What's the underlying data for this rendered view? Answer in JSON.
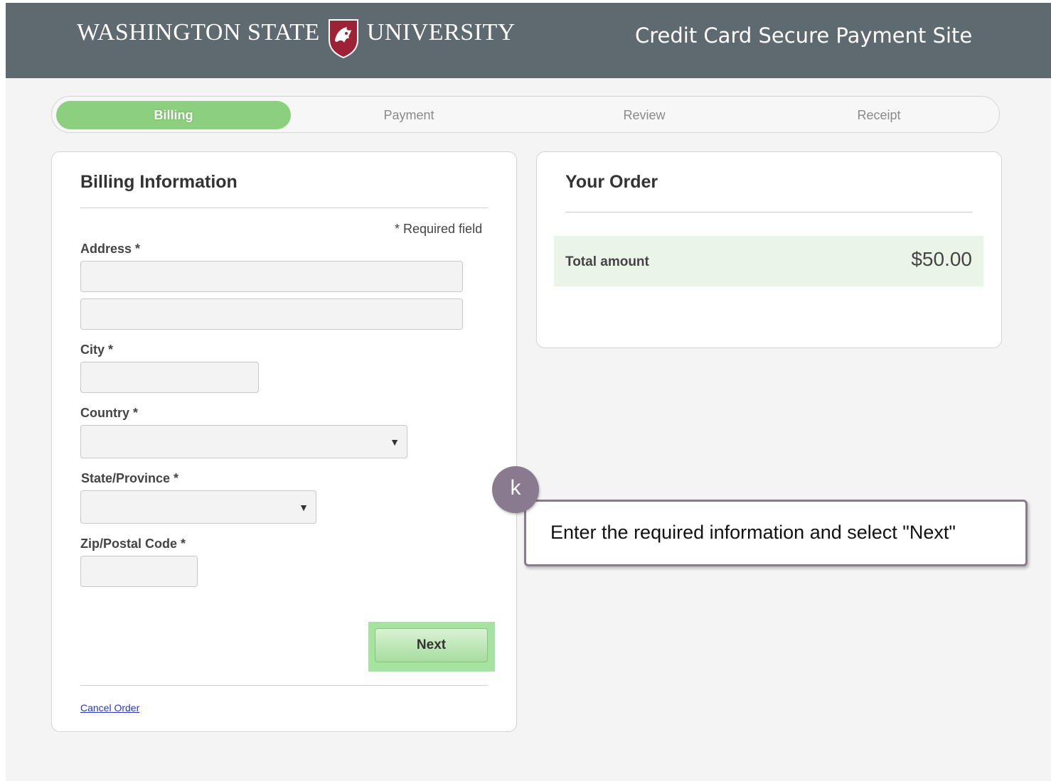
{
  "header": {
    "logo_left": "WASHINGTON STATE",
    "logo_right": "UNIVERSITY",
    "site_title": "Credit Card Secure Payment Site"
  },
  "steps": [
    {
      "label": "Billing",
      "active": true
    },
    {
      "label": "Payment",
      "active": false
    },
    {
      "label": "Review",
      "active": false
    },
    {
      "label": "Receipt",
      "active": false
    }
  ],
  "billing": {
    "title": "Billing Information",
    "required_note": "* Required field",
    "address_label": "Address *",
    "address_line1_value": "",
    "address_line2_value": "",
    "city_label": "City *",
    "city_value": "",
    "country_label": "Country *",
    "country_value": "",
    "state_label": "State/Province *",
    "state_value": "",
    "zip_label": "Zip/Postal Code *",
    "zip_value": "",
    "next_label": "Next",
    "cancel_label": "Cancel Order"
  },
  "order": {
    "title": "Your Order",
    "total_label": "Total amount",
    "total_value": "$50.00"
  },
  "annotation": {
    "badge": "k",
    "text": "Enter the required information and select \"Next\""
  },
  "colors": {
    "header_bg": "#5f6a70",
    "active_step": "#8ccf7e",
    "next_highlight": "#a6e3a1",
    "callout_border": "#8a7a8f",
    "logo_shield": "#9d2235"
  },
  "icons": {
    "logo": "wsu-cougar-shield-icon",
    "select": "triangle-down-icon"
  }
}
